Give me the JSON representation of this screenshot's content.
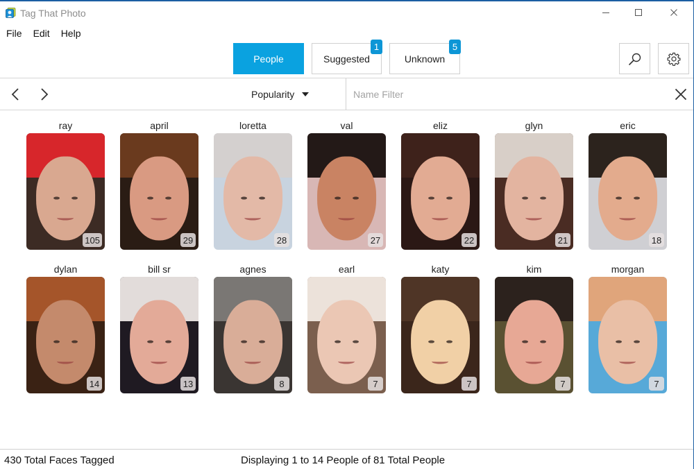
{
  "window": {
    "title": "Tag That Photo",
    "controls": {
      "minimize": "minimize",
      "maximize": "maximize",
      "close": "close"
    }
  },
  "menu": {
    "items": [
      "File",
      "Edit",
      "Help"
    ]
  },
  "tabs": [
    {
      "label": "People",
      "active": true,
      "badge": null
    },
    {
      "label": "Suggested",
      "active": false,
      "badge": "1"
    },
    {
      "label": "Unknown",
      "active": false,
      "badge": "5"
    }
  ],
  "tools": {
    "search_icon": "search-icon",
    "settings_icon": "gear-icon"
  },
  "toolbar": {
    "prev_icon": "chevron-left-icon",
    "next_icon": "chevron-right-icon",
    "sort_label": "Popularity",
    "filter_placeholder": "Name Filter",
    "filter_value": "",
    "clear_icon": "close-icon"
  },
  "colors": {
    "accent": "#0aa2e0",
    "badge": "#0d96d6",
    "window_border": "#1b5ea3"
  },
  "people": [
    {
      "name": "ray",
      "count": "105",
      "bg": "#3c2b24",
      "hair": "#d7262b",
      "skin": "#d9a890"
    },
    {
      "name": "april",
      "count": "29",
      "bg": "#2a1c14",
      "hair": "#6a3a1e",
      "skin": "#d99a82"
    },
    {
      "name": "loretta",
      "count": "28",
      "bg": "#c8d3df",
      "hair": "#d4d0cf",
      "skin": "#e3b9a7"
    },
    {
      "name": "val",
      "count": "27",
      "bg": "#d8b7b5",
      "hair": "#231917",
      "skin": "#c98363"
    },
    {
      "name": "eliz",
      "count": "22",
      "bg": "#2b1815",
      "hair": "#3e221b",
      "skin": "#e2ab93"
    },
    {
      "name": "glyn",
      "count": "21",
      "bg": "#4a2c23",
      "hair": "#d8cfc8",
      "skin": "#e3b4a0"
    },
    {
      "name": "eric",
      "count": "18",
      "bg": "#cfcfd3",
      "hair": "#2c231d",
      "skin": "#e3ab8d"
    },
    {
      "name": "dylan",
      "count": "14",
      "bg": "#3a2214",
      "hair": "#a5552a",
      "skin": "#c48a6c"
    },
    {
      "name": "bill sr",
      "count": "13",
      "bg": "#1f1a22",
      "hair": "#e2dcda",
      "skin": "#e3aa98"
    },
    {
      "name": "agnes",
      "count": "8",
      "bg": "#3a3532",
      "hair": "#7a7774",
      "skin": "#d9ad98"
    },
    {
      "name": "earl",
      "count": "7",
      "bg": "#7b5f4e",
      "hair": "#ece2da",
      "skin": "#ebc7b4"
    },
    {
      "name": "katy",
      "count": "7",
      "bg": "#3b261b",
      "hair": "#4f3526",
      "skin": "#f1d0a6"
    },
    {
      "name": "kim",
      "count": "7",
      "bg": "#5a5132",
      "hair": "#2c221d",
      "skin": "#e7a895"
    },
    {
      "name": "morgan",
      "count": "7",
      "bg": "#57a9d8",
      "hair": "#e0a57b",
      "skin": "#e9bfa6"
    }
  ],
  "status": {
    "faces_tagged": "430 Total Faces Tagged",
    "displaying": "Displaying 1 to 14 People of 81 Total People"
  }
}
